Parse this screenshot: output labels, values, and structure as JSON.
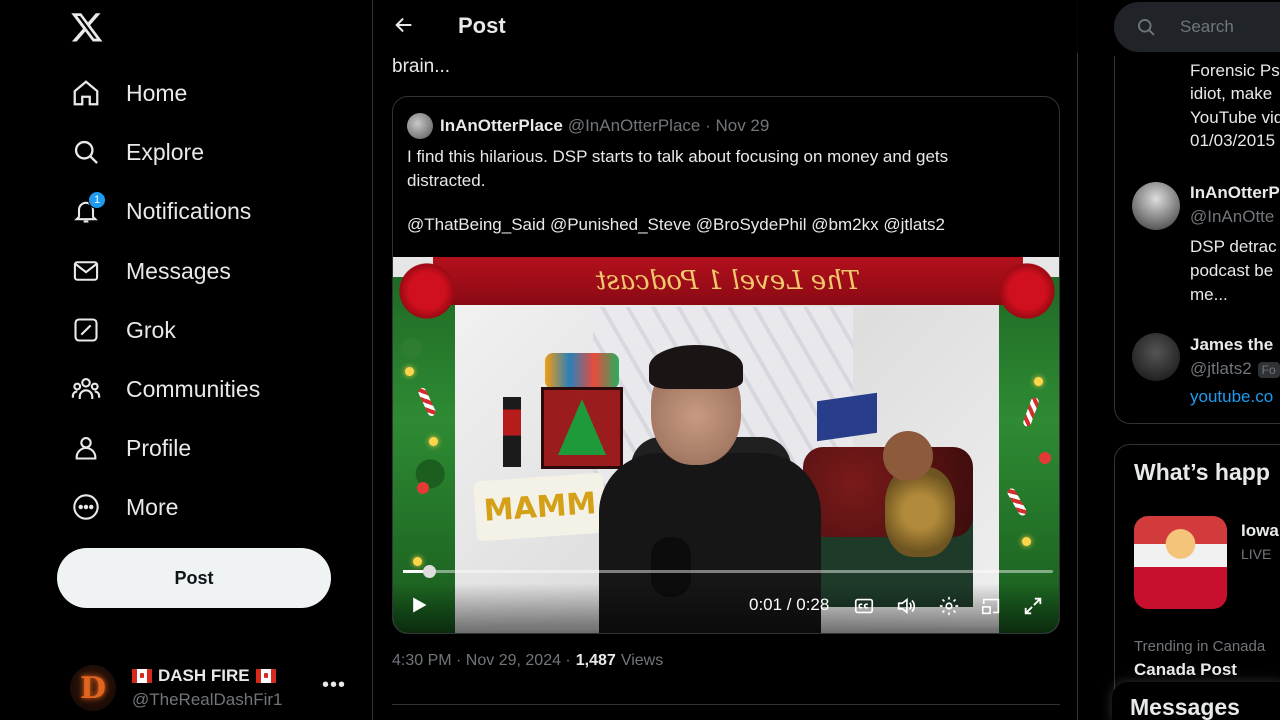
{
  "sidebar": {
    "logo": "x-logo-icon",
    "items": [
      {
        "label": "Home",
        "icon": "home-icon"
      },
      {
        "label": "Explore",
        "icon": "search-icon"
      },
      {
        "label": "Notifications",
        "icon": "bell-icon",
        "badge": "1"
      },
      {
        "label": "Messages",
        "icon": "envelope-icon"
      },
      {
        "label": "Grok",
        "icon": "grok-icon"
      },
      {
        "label": "Communities",
        "icon": "people-icon"
      },
      {
        "label": "Profile",
        "icon": "person-icon"
      },
      {
        "label": "More",
        "icon": "more-circle-icon"
      }
    ],
    "post_button": "Post",
    "account": {
      "avatar_letter": "D",
      "name": "DASH FIRE",
      "handle": "@TheRealDashFir1",
      "more": "•••"
    }
  },
  "main": {
    "header_title": "Post",
    "tweet_text_tail": "brain...",
    "quote": {
      "name": "InAnOtterPlace",
      "handle": "@InAnOtterPlace · Nov 29",
      "text": "I find this hilarious. DSP starts to talk about focusing on money and gets distracted.",
      "mentions": "@ThatBeing_Said @Punished_Steve @BroSydePhil @bm2kx @jtlats2",
      "video": {
        "banner_text": "The Level 1 Podcast",
        "sign_text": "MAMM",
        "time": "0:01 / 0:28",
        "progress": 0.04
      }
    },
    "meta": {
      "time": "4:30 PM · Nov 29, 2024 ·",
      "views_count": "1,487",
      "views_label": "Views"
    }
  },
  "right": {
    "search_placeholder": "Search",
    "related_text_1": [
      "Forensic Ps",
      "idiot, make",
      "YouTube vid",
      "01/03/2015"
    ],
    "related_user_1": {
      "name": "InAnOtterP",
      "handle": "@InAnOtte",
      "bio": [
        "DSP detrac",
        "podcast be",
        "me..."
      ]
    },
    "related_user_2": {
      "name": "James the",
      "handle": "@jtlats2",
      "badge": "Fo",
      "link": "youtube.co"
    },
    "trends_title": "What’s happ",
    "trend_1": {
      "title": "Iowa",
      "status": "LIVE"
    },
    "trend_2": {
      "subtitle": "Trending in Canada",
      "name": "Canada Post"
    },
    "messages_drawer": "Messages"
  },
  "colors": {
    "accent": "#1d9bf0",
    "background": "#000000",
    "text_primary": "#e7e9ea",
    "text_secondary": "#71767b",
    "border": "#2f3336"
  }
}
